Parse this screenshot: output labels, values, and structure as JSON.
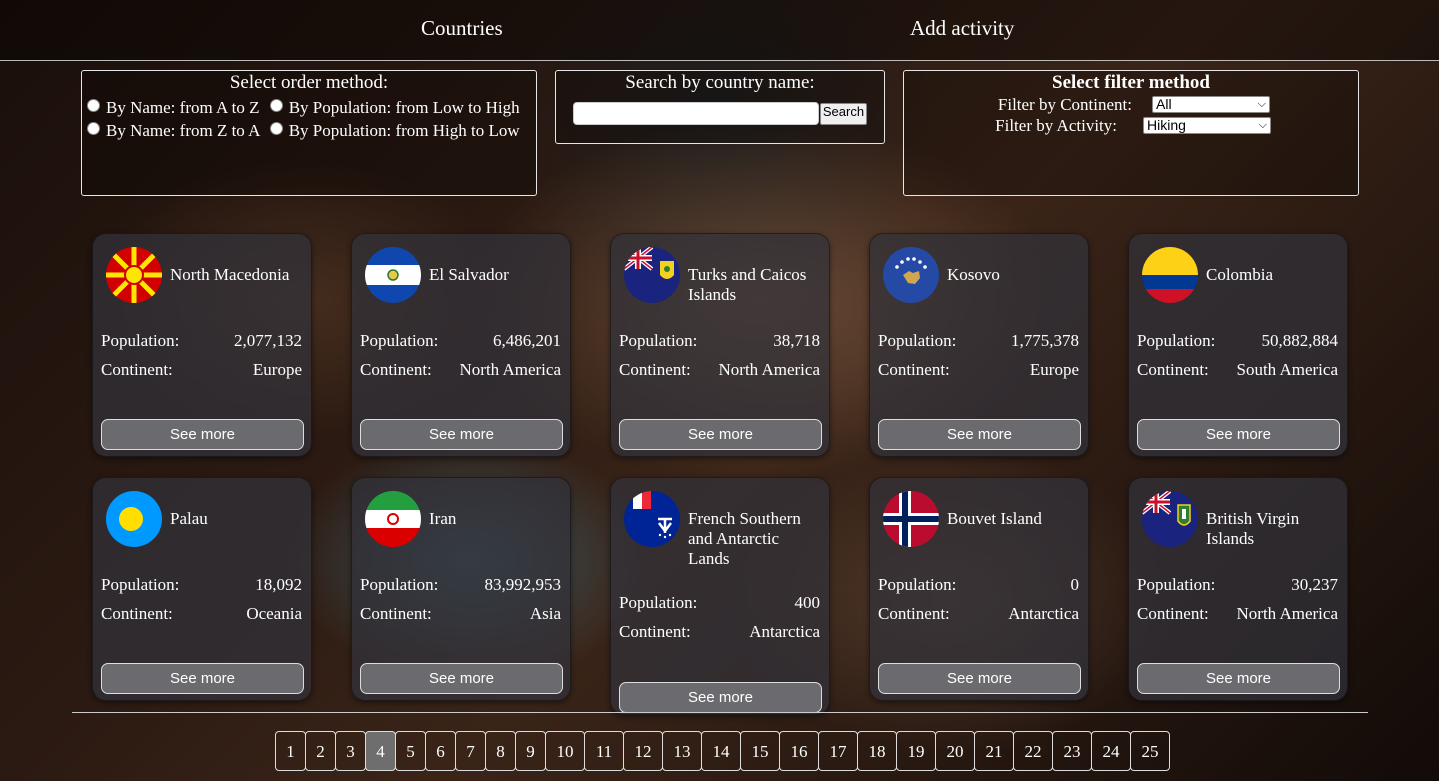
{
  "nav": {
    "countries": "Countries",
    "add_activity": "Add activity"
  },
  "order": {
    "title": "Select order method:",
    "name_az": "By Name: from A to Z",
    "pop_low_high": "By Population: from Low to High",
    "name_za": "By Name: from Z to A",
    "pop_high_low": "By Population: from High to Low"
  },
  "search": {
    "title": "Search by country name:",
    "value": "",
    "button": "Search"
  },
  "filter": {
    "title": "Select filter method",
    "continent_label": "Filter by Continent:",
    "continent_value": "All",
    "activity_label": "Filter by Activity:",
    "activity_value": "Hiking"
  },
  "labels": {
    "population": "Population:",
    "continent": "Continent:",
    "see_more": "See more"
  },
  "countries": [
    {
      "name": "North Macedonia",
      "population": "2,077,132",
      "continent": "Europe",
      "flag": "north-macedonia-flag"
    },
    {
      "name": "El Salvador",
      "population": "6,486,201",
      "continent": "North America",
      "flag": "el-salvador-flag"
    },
    {
      "name": "Turks and Caicos Islands",
      "population": "38,718",
      "continent": "North America",
      "flag": "turks-caicos-flag"
    },
    {
      "name": "Kosovo",
      "population": "1,775,378",
      "continent": "Europe",
      "flag": "kosovo-flag"
    },
    {
      "name": "Colombia",
      "population": "50,882,884",
      "continent": "South America",
      "flag": "colombia-flag"
    },
    {
      "name": "Palau",
      "population": "18,092",
      "continent": "Oceania",
      "flag": "palau-flag"
    },
    {
      "name": "Iran",
      "population": "83,992,953",
      "continent": "Asia",
      "flag": "iran-flag"
    },
    {
      "name": "French Southern and Antarctic Lands",
      "population": "400",
      "continent": "Antarctica",
      "flag": "french-southern-lands-flag"
    },
    {
      "name": "Bouvet Island",
      "population": "0",
      "continent": "Antarctica",
      "flag": "bouvet-island-flag"
    },
    {
      "name": "British Virgin Islands",
      "population": "30,237",
      "continent": "North America",
      "flag": "british-virgin-islands-flag"
    }
  ],
  "pagination": {
    "pages": [
      "1",
      "2",
      "3",
      "4",
      "5",
      "6",
      "7",
      "8",
      "9",
      "10",
      "11",
      "12",
      "13",
      "14",
      "15",
      "16",
      "17",
      "18",
      "19",
      "20",
      "21",
      "22",
      "23",
      "24",
      "25"
    ],
    "current": "4"
  }
}
